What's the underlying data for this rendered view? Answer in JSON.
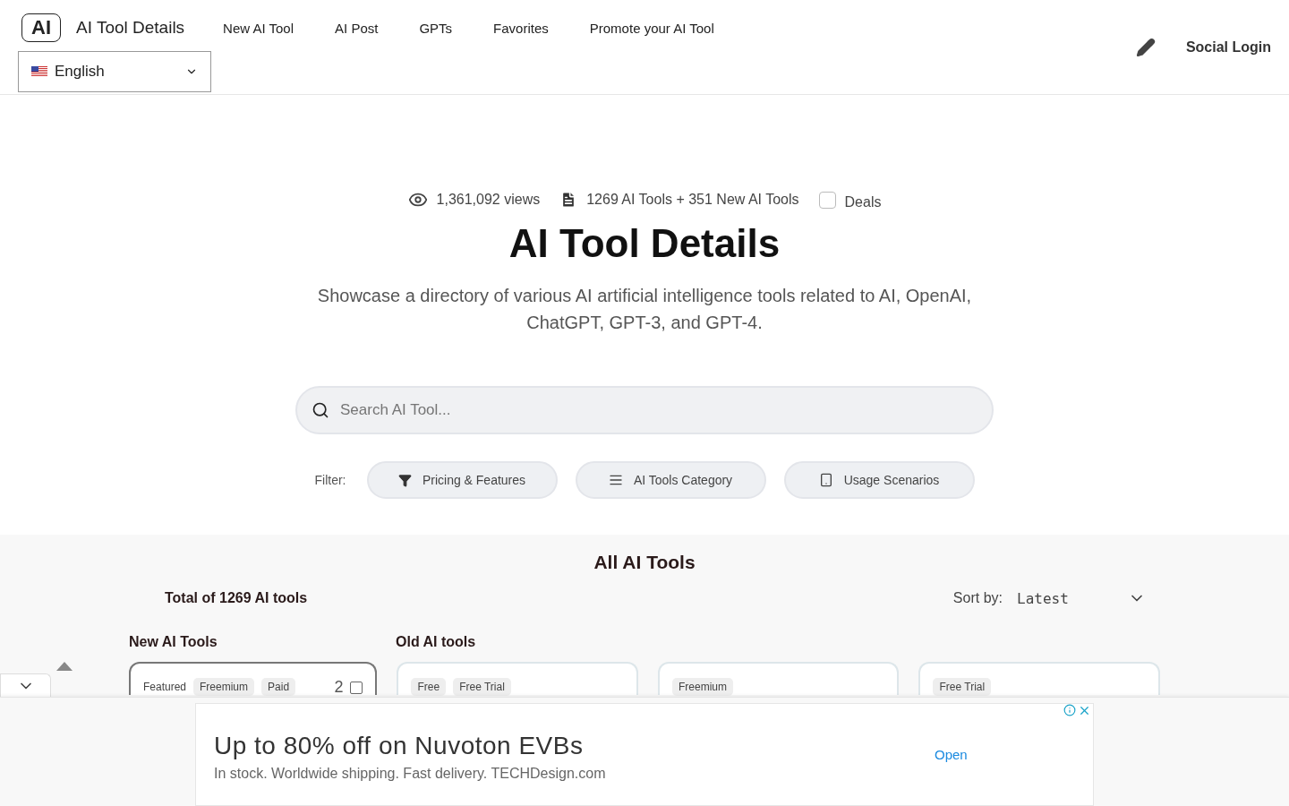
{
  "header": {
    "logo": "AI",
    "site_name": "AI Tool Details",
    "nav": [
      "New AI Tool",
      "AI Post",
      "GPTs",
      "Favorites",
      "Promote your AI Tool"
    ],
    "language": "English",
    "login": "Social Login"
  },
  "hero": {
    "views": "1,361,092 views",
    "tools_count": "1269 AI Tools + 351 New AI Tools",
    "deals": {
      "label": "Deals",
      "checked": false
    },
    "title": "AI Tool Details",
    "subtitle": "Showcase a directory of various AI artificial intelligence tools related to AI, OpenAI, ChatGPT, GPT-3, and GPT-4.",
    "search": {
      "placeholder": "Search AI Tool..."
    },
    "filter_label": "Filter:",
    "filters": [
      {
        "kind": "funnel",
        "label": "Pricing & Features"
      },
      {
        "kind": "list",
        "label": "AI Tools Category"
      },
      {
        "kind": "tablet",
        "label": "Usage Scenarios"
      }
    ]
  },
  "tools": {
    "title": "All AI Tools",
    "total": "Total of 1269 AI tools",
    "sort_label": "Sort by:",
    "sort_value": "Latest",
    "new_heading": "New AI Tools",
    "old_heading": "Old AI tools",
    "cards": [
      {
        "featured": "Featured",
        "tags": [
          "Freemium",
          "Paid"
        ],
        "count": "2",
        "compare_checked": false
      },
      {
        "tags": [
          "Free",
          "Free Trial"
        ]
      },
      {
        "tags": [
          "Freemium"
        ]
      },
      {
        "tags": [
          "Free Trial"
        ]
      }
    ]
  },
  "ad": {
    "headline": "Up to 80% off on Nuvoton EVBs",
    "body": "In stock. Worldwide shipping. Fast delivery. TECHDesign.com",
    "action": "Open"
  }
}
